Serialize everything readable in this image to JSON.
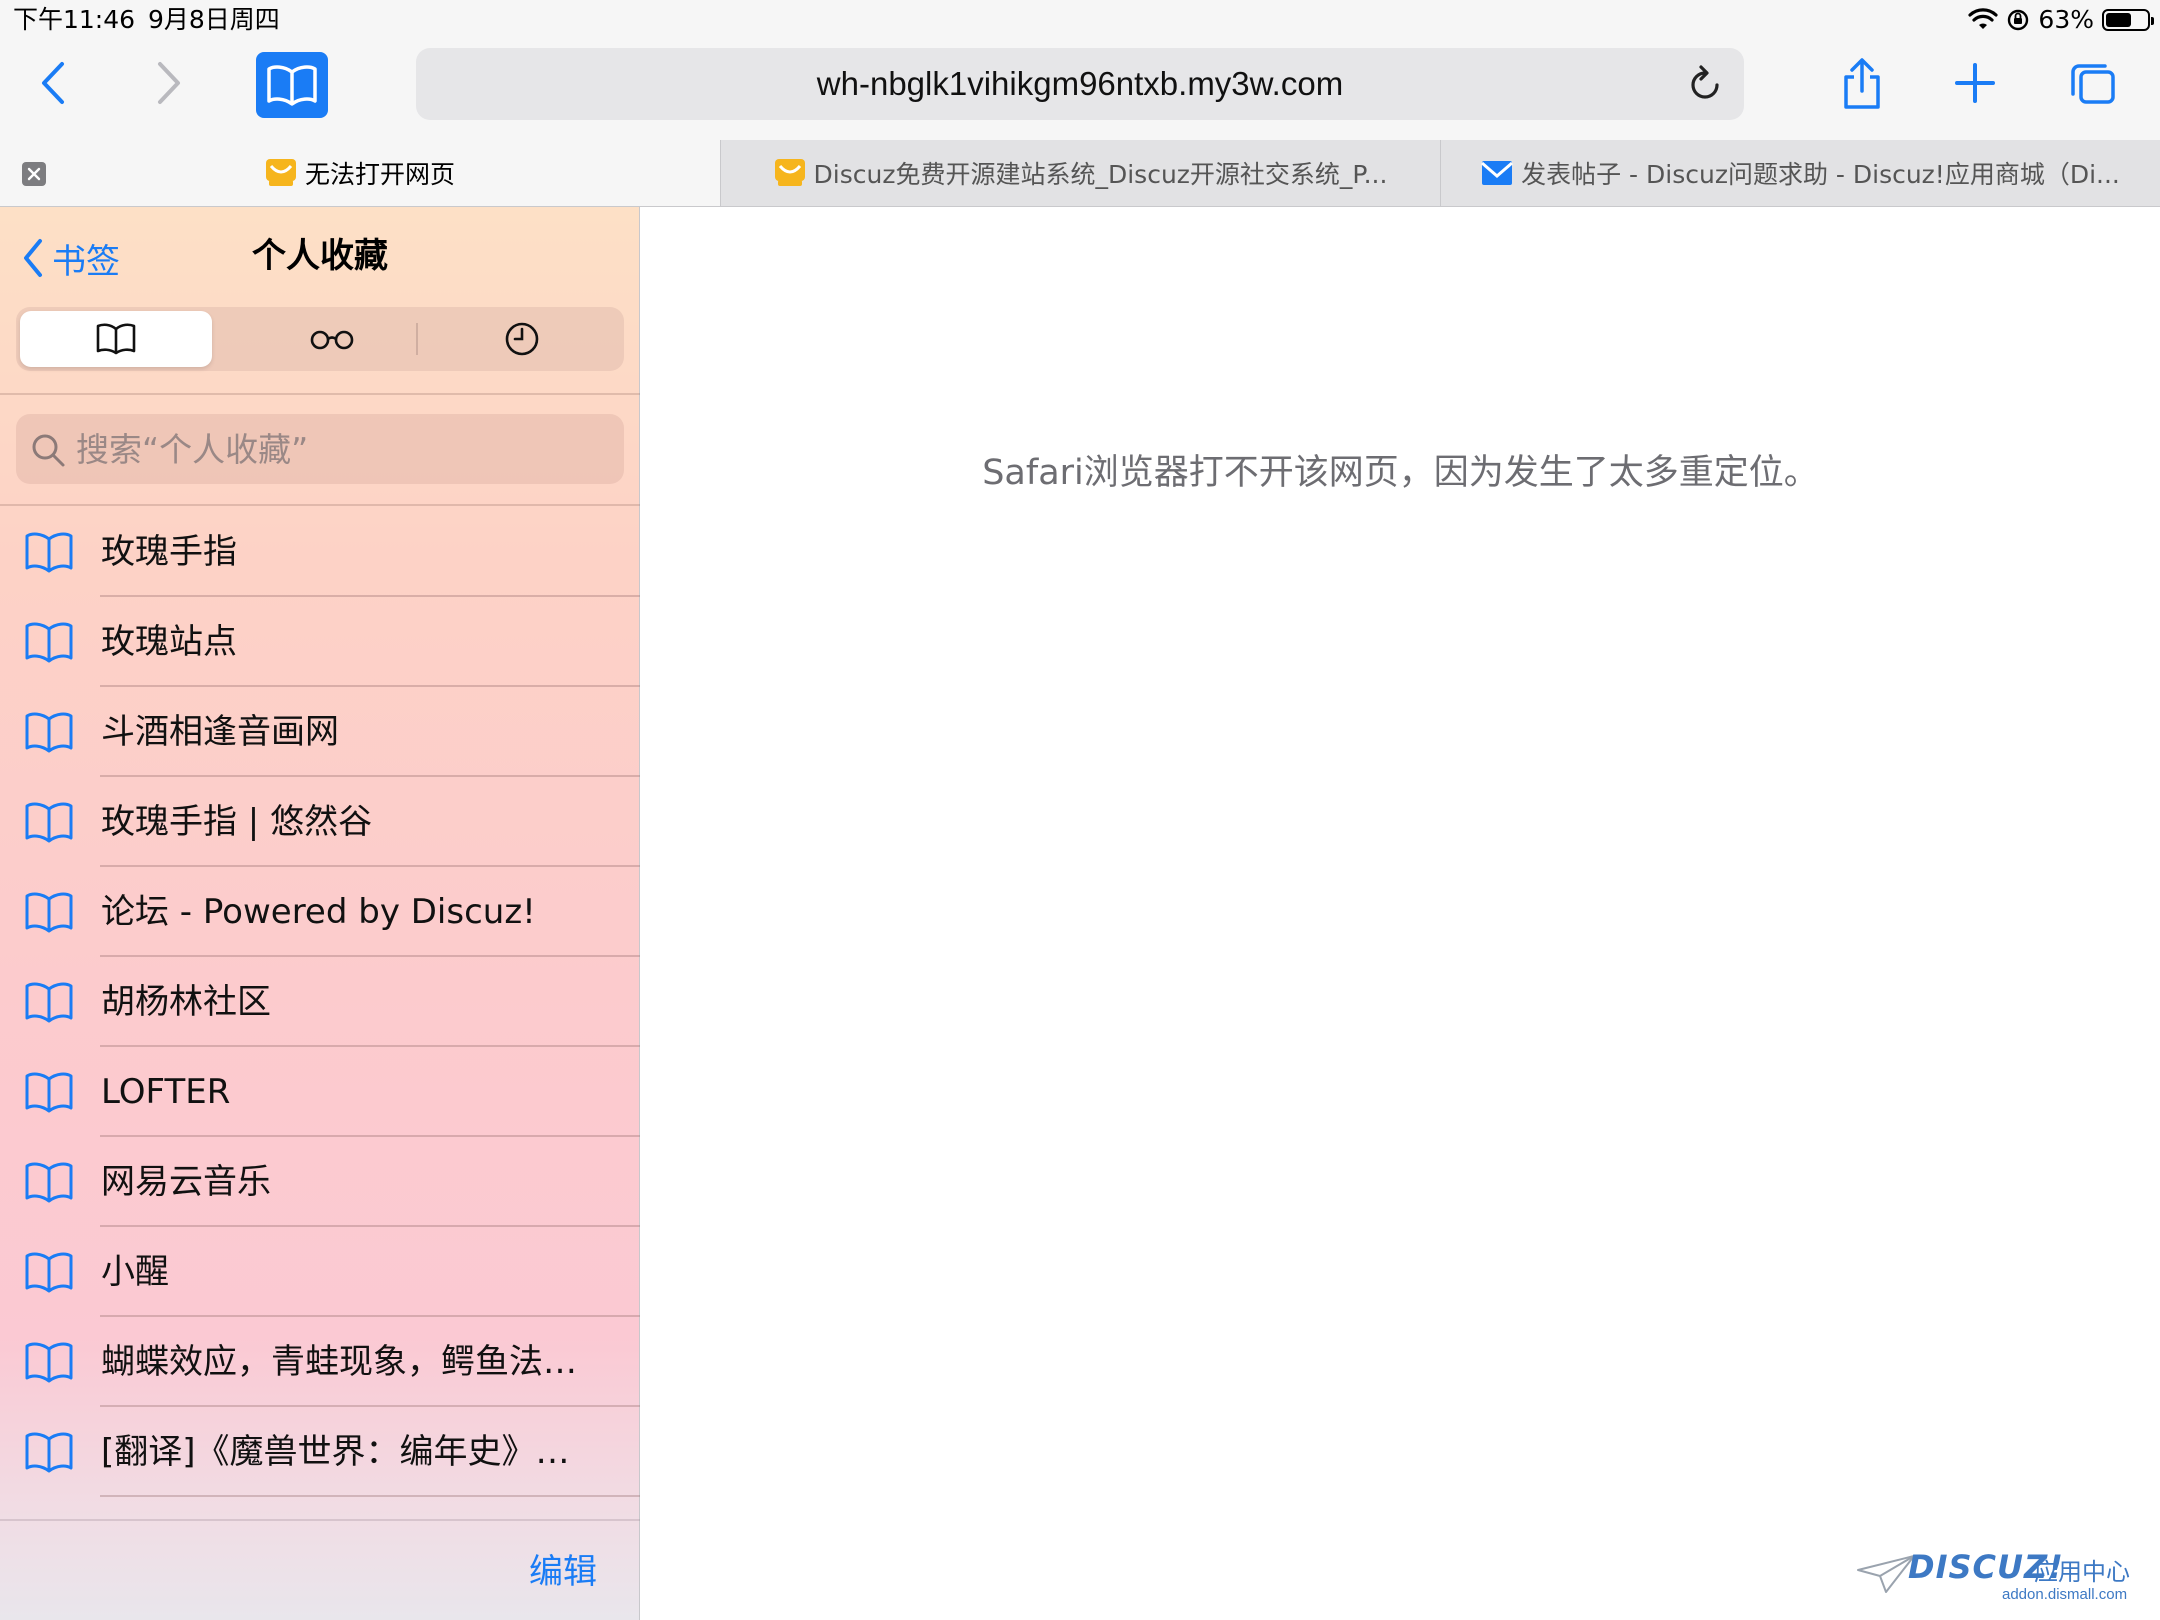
{
  "status_bar": {
    "time": "下午11:46",
    "date": "9月8日周四",
    "battery_percent": "63%",
    "battery_level": 0.63
  },
  "toolbar": {
    "url": "wh-nbglk1vihikgm96ntxb.my3w.com",
    "accent_color": "#1a7cf5"
  },
  "tabs": [
    {
      "title": "无法打开网页",
      "active": true,
      "favicon": "discuz-favicon"
    },
    {
      "title": "Discuz免费开源建站系统_Discuz开源社交系统_P...",
      "active": false,
      "favicon": "discuz-favicon"
    },
    {
      "title": "发表帖子 - Discuz问题求助 - Discuz!应用商城（Di...",
      "active": false,
      "favicon": "mail-favicon"
    }
  ],
  "sidebar": {
    "back_label": "书签",
    "title": "个人收藏",
    "search_placeholder": "搜索“个人收藏”",
    "bookmarks": [
      {
        "label": "玫瑰手指"
      },
      {
        "label": "玫瑰站点"
      },
      {
        "label": "斗酒相逢音画网"
      },
      {
        "label": "玫瑰手指 | 悠然谷"
      },
      {
        "label": "论坛 - Powered by Discuz!"
      },
      {
        "label": "胡杨林社区"
      },
      {
        "label": "LOFTER"
      },
      {
        "label": "网易云音乐"
      },
      {
        "label": "小醒"
      },
      {
        "label": "蝴蝶效应，青蛙现象，鳄鱼法则，鸟笼逻辑"
      },
      {
        "label": "[翻译]《魔兽世界：编年史》第一卷"
      }
    ],
    "edit_label": "编辑"
  },
  "content": {
    "error_message": "Safari浏览器打不开该网页，因为发生了太多重定位。"
  },
  "watermark": {
    "logo": "DISCUZ!",
    "subtitle": "应用中心",
    "domain": "addon.dismall.com"
  }
}
